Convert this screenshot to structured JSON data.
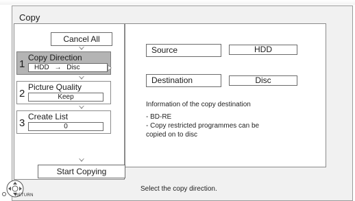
{
  "screen": {
    "title": "Copy"
  },
  "buttons": {
    "cancel_all": "Cancel All",
    "start_copying": "Start Copying"
  },
  "menu": [
    {
      "number": "1",
      "label": "Copy Direction",
      "value_from": "HDD",
      "value_arrow": "→",
      "value_to": "Disc",
      "selected": true
    },
    {
      "number": "2",
      "label": "Picture Quality",
      "value": "Keep",
      "selected": false
    },
    {
      "number": "3",
      "label": "Create List",
      "value": "0",
      "selected": false
    }
  ],
  "details": {
    "source_label": "Source",
    "source_value": "HDD",
    "destination_label": "Destination",
    "destination_value": "Disc",
    "info_heading": "Information of the copy destination",
    "info_lines": [
      "- BD-RE",
      "- Copy restricted programmes can be",
      "copied on to disc"
    ]
  },
  "status": {
    "hint": "Select the copy direction.",
    "return_label": "RETURN"
  },
  "colors": {
    "selected_bg": "#b4b4b4",
    "panel_bg": "#f1f1f1",
    "border": "#8a8a8a"
  }
}
